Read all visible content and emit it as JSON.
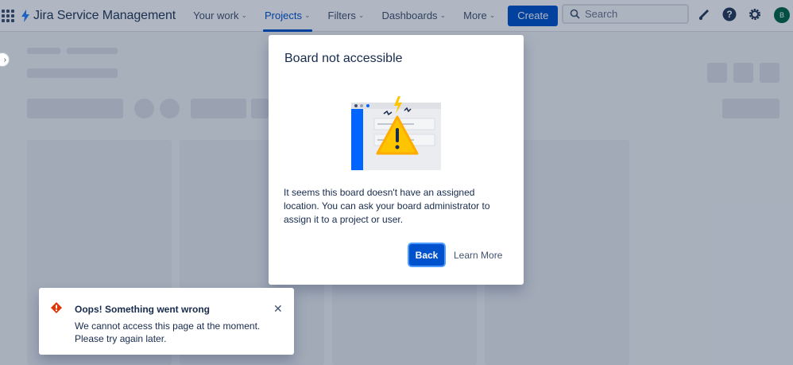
{
  "nav": {
    "brand": "Jira Service Management",
    "items": [
      {
        "label": "Your work",
        "active": false
      },
      {
        "label": "Projects",
        "active": true
      },
      {
        "label": "Filters",
        "active": false
      },
      {
        "label": "Dashboards",
        "active": false
      },
      {
        "label": "More",
        "active": false
      }
    ],
    "create_label": "Create",
    "search_placeholder": "Search",
    "avatar_initial": "B"
  },
  "modal": {
    "title": "Board not accessible",
    "body": "It seems this board doesn't have an assigned location. You can ask your board administrator to assign it to a project or user.",
    "primary_button": "Back",
    "secondary_button": "Learn More"
  },
  "flag": {
    "title": "Oops! Something went wrong",
    "description": "We cannot access this page at the moment. Please try again later."
  },
  "colors": {
    "brand": "#0052cc",
    "warning": "#ffab00",
    "error": "#de350b"
  }
}
